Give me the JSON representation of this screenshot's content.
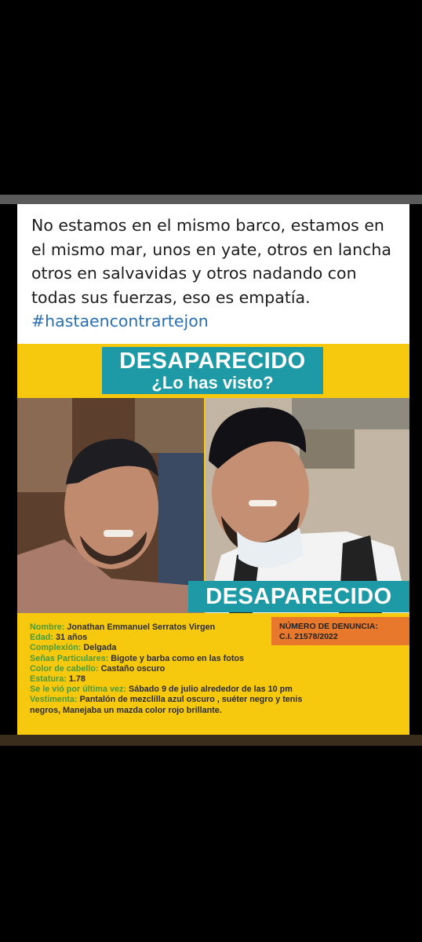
{
  "post": {
    "caption_text": "No estamos en el mismo barco, estamos en el mismo mar, unos en yate, otros en lancha otros en salvavidas y otros nadando con todas sus fuerzas, eso es empatía.",
    "hashtag": "#hastaencontrartejon"
  },
  "poster": {
    "banner_title": "DESAPARECIDO",
    "banner_subtitle": "¿Lo has visto?",
    "bottom_banner": "DESAPARECIDO",
    "denuncia_label": "NÚMERO DE DENUNCIA:",
    "denuncia_value": "C.I. 21578/2022",
    "info": {
      "nombre_label": "Nombre:",
      "nombre_value": "Jonathan Emmanuel Serratos Virgen",
      "edad_label": "Edad:",
      "edad_value": "31 años",
      "complexion_label": "Complexión:",
      "complexion_value": "Delgada",
      "senas_label": "Señas Particulares:",
      "senas_value": "Bigote y barba como en las fotos",
      "cabello_label": "Color de cabello:",
      "cabello_value": "Castaño oscuro",
      "estatura_label": "Estatura:",
      "estatura_value": "1.78",
      "visto_label": "Se le vió por última vez:",
      "visto_value": "Sábado 9 de julio alrededor de las 10 pm",
      "vestimenta_label": "Vestimenta:",
      "vestimenta_value": "Pantalón de mezclilla azul oscuro , suéter negro y tenis negros, Manejaba un mazda color rojo brillante."
    }
  },
  "colors": {
    "poster_yellow": "#f6c90e",
    "banner_teal": "#1e9aa6",
    "label_green": "#4a9a3a",
    "denuncia_orange": "#e8792c",
    "hashtag_blue": "#2a6fb0"
  }
}
